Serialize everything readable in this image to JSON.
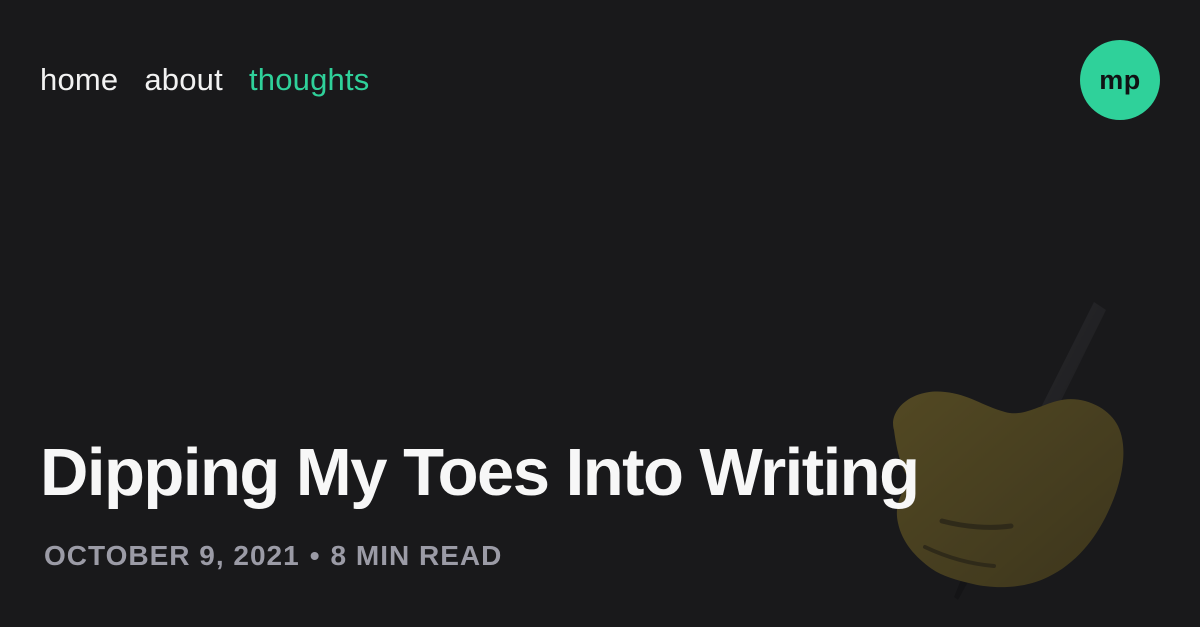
{
  "nav": {
    "items": [
      {
        "label": "home",
        "active": false
      },
      {
        "label": "about",
        "active": false
      },
      {
        "label": "thoughts",
        "active": true
      }
    ]
  },
  "logo": {
    "text": "mp",
    "color": "#2fd19a"
  },
  "post": {
    "title": "Dipping My Toes Into Writing",
    "date": "OCTOBER 9, 2021",
    "separator": "•",
    "read_time": "8 MIN READ"
  },
  "colors": {
    "background": "#19191b",
    "accent": "#2fd19a",
    "meta": "#9b9ba6"
  }
}
